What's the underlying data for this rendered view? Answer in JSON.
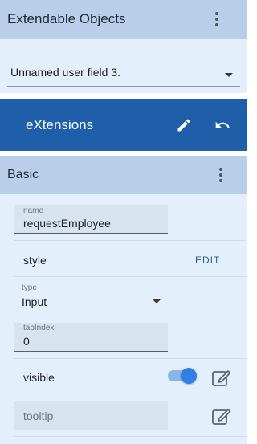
{
  "extendable_objects": {
    "title": "Extendable Objects",
    "selected_value": "Unnamed user field 3."
  },
  "banner": {
    "title": "eXtensions"
  },
  "basic": {
    "title": "Basic",
    "name_field": {
      "label": "name",
      "value": "requestEmployee"
    },
    "style_row": {
      "label": "style",
      "action": "EDIT"
    },
    "type_field": {
      "label": "type",
      "value": "Input"
    },
    "tabindex_field": {
      "label": "tabIndex",
      "value": "0"
    },
    "visible_row": {
      "label": "visible",
      "toggle_on": true
    },
    "tooltip_field": {
      "placeholder": "tooltip"
    }
  },
  "colors": {
    "header_bg": "#b9cfe9",
    "panel_bg": "#e3f0fb",
    "banner_bg": "#1f5ea8",
    "accent": "#2f80e0"
  },
  "icons": [
    "more-vert-icon",
    "pencil-icon",
    "undo-icon",
    "edit-square-icon",
    "chevron-down-icon"
  ]
}
